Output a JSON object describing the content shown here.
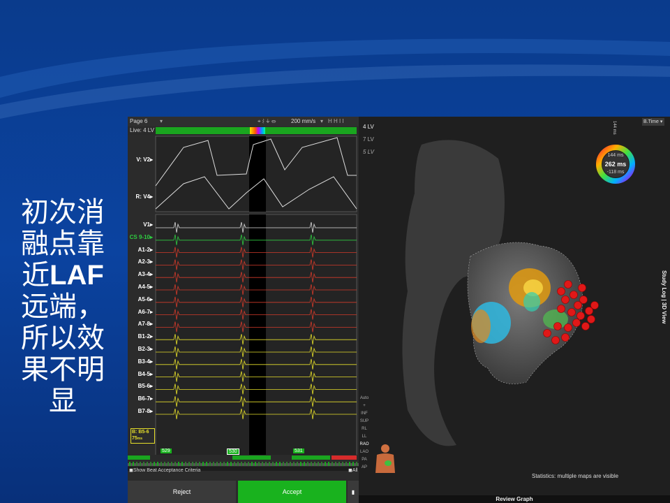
{
  "slide": {
    "lines": [
      "初次消",
      "融点靠",
      "LAF",
      "远端，",
      "所以效",
      "果不明",
      "显"
    ],
    "line3_prefix": "近"
  },
  "ep_panel": {
    "page": "Page 6",
    "live": "Live: 4 LV",
    "speed": "200 mm/s",
    "channels_top": [
      "V: V2",
      "R: V4"
    ],
    "channels": [
      "V1",
      "CS 9-10",
      "A1-2",
      "A2-3",
      "A3-4",
      "A4-5",
      "A5-6",
      "A6-7",
      "A7-8",
      "B1-2",
      "B2-3",
      "B3-4",
      "B4-5",
      "B5-6",
      "B6-7",
      "B7-8"
    ],
    "ref_channel": "B: B5-6",
    "ref_value": "75",
    "ref_unit": "ms",
    "cycle_lengths": [
      "529",
      "530",
      "531"
    ],
    "show_beat_criteria": "Show Beat Acceptance Criteria",
    "all_label": "All",
    "reject_label": "Reject",
    "accept_label": "Accept"
  },
  "map_panel": {
    "maps": [
      "4 LV",
      "7 LV",
      "5 LV"
    ],
    "view_select": "B.Time",
    "ring_top": "144 ms",
    "ring_center": "262 ms",
    "ring_bottom": "-118 ms",
    "ring_side": "144 ms",
    "side_buttons": [
      "Auto",
      "+",
      "INF",
      "SUP",
      "RL",
      "LL",
      "RAO",
      "LAO",
      "PA",
      "AP"
    ],
    "stats": "Statistics: multiple maps are visible",
    "review": "Review Graph",
    "study_log": "Study Log | 3D View"
  },
  "colors": {
    "accept": "#19b21e",
    "reject": "#3a3a3a",
    "cs_green": "#2ecc40",
    "a_red": "#d23a2a",
    "b_yellow": "#e6df2a"
  }
}
